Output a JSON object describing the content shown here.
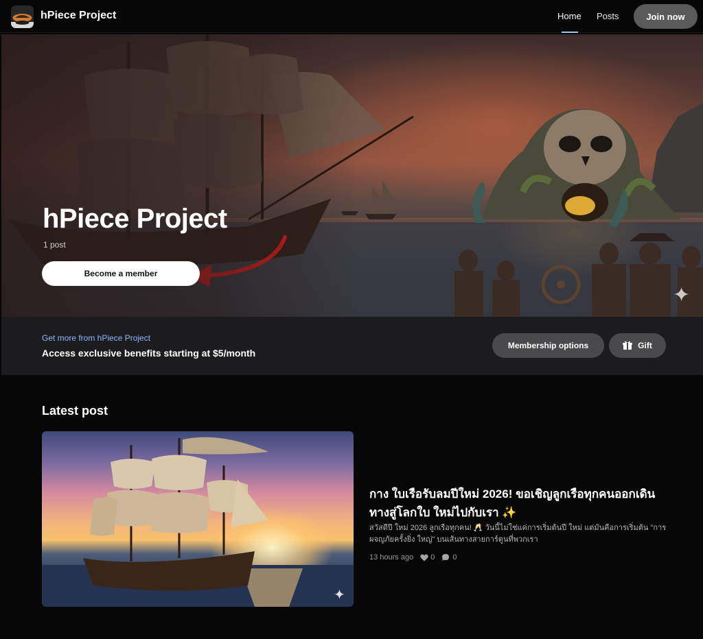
{
  "header": {
    "brand": "hPiece Project",
    "nav": [
      {
        "label": "Home",
        "active": true
      },
      {
        "label": "Posts",
        "active": false
      }
    ],
    "join_label": "Join now"
  },
  "hero": {
    "title": "hPiece Project",
    "post_count": "1 post",
    "cta_label": "Become a member",
    "annotation": "red-arrow pointing to Become a member"
  },
  "membership": {
    "kicker": "Get more from hPiece Project",
    "description": "Access exclusive benefits starting at $5/month",
    "options_label": "Membership options",
    "gift_label": "Gift"
  },
  "latest": {
    "heading": "Latest post",
    "post": {
      "title": "กาง ใบเรือรับลมปีใหม่ 2026! ขอเชิญลูกเรือทุกคนออกเดินทางสู่โลกใบ ใหม่ไปกับเรา ✨",
      "excerpt": "สวัสดีปี ใหม่ 2026 ลูกเรือทุกคน! 🥂 วันนี้ไม่ใช่แค่การเริ่มต้นปี ใหม่ แต่มันคือการเริ่มต้น \"การผจญภัยครั้งยิ่ง ใหญ่\" บนเส้นทางสายการ์ตูนที่พวกเรา",
      "time": "13 hours ago",
      "likes": "0",
      "comments": "0"
    }
  },
  "colors": {
    "background": "#070707",
    "strip": "#1c1c1e",
    "accent_link": "#8fb8ff",
    "arrow": "#d91a1a"
  },
  "icons": [
    "logo-image",
    "sparkle-icon",
    "gift-icon",
    "heart-icon",
    "comment-icon"
  ]
}
